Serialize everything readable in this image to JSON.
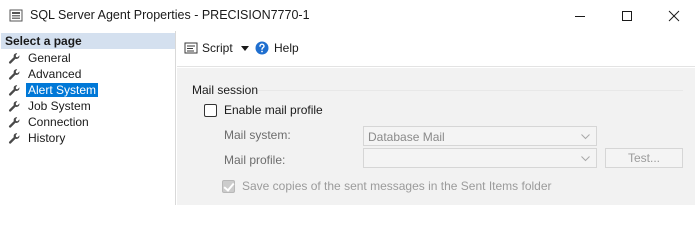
{
  "window": {
    "title": "SQL Server Agent Properties - PRECISION7770-1",
    "controls": {
      "minimize": "minimize-icon",
      "maximize": "maximize-icon",
      "close": "close-icon"
    }
  },
  "left_pane": {
    "header": "Select a page",
    "items": [
      {
        "label": "General",
        "selected": false
      },
      {
        "label": "Advanced",
        "selected": false
      },
      {
        "label": "Alert System",
        "selected": true
      },
      {
        "label": "Job System",
        "selected": false
      },
      {
        "label": "Connection",
        "selected": false
      },
      {
        "label": "History",
        "selected": false
      }
    ]
  },
  "toolbar": {
    "script_label": "Script",
    "help_label": "Help"
  },
  "mail_session": {
    "group_title": "Mail session",
    "enable_label": "Enable mail profile",
    "enable_checked": false,
    "mail_system_label": "Mail system:",
    "mail_system_value": "Database Mail",
    "mail_profile_label": "Mail profile:",
    "mail_profile_value": "",
    "test_button_label": "Test...",
    "save_copies_label": "Save copies of the sent messages in the Sent Items folder",
    "save_copies_checked": true
  },
  "colors": {
    "selection": "#0078d7",
    "header_bg": "#d4e0ef",
    "content_bg": "#f2f2f2",
    "disabled_text": "#9b9b9b"
  }
}
